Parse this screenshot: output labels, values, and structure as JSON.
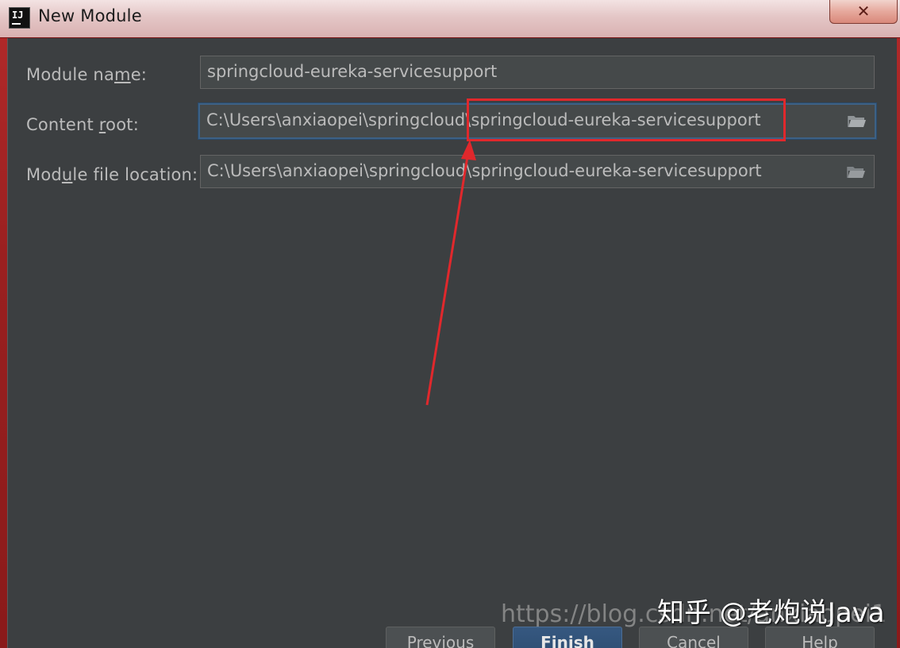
{
  "window": {
    "title": "New Module",
    "icon_label": "IJ",
    "close_symbol": "✕"
  },
  "fields": {
    "module_name": {
      "label_pre": "Module na",
      "label_mnemonic": "m",
      "label_post": "e:",
      "value": "springcloud-eureka-servicesupport"
    },
    "content_root": {
      "label_pre": "Content ",
      "label_mnemonic": "r",
      "label_post": "oot:",
      "value": "C:\\Users\\anxiaopei\\springcloud\\springcloud-eureka-servicesupport"
    },
    "module_file_location": {
      "label_pre": "Module file location:",
      "label_mnemonic": "",
      "label_post": "",
      "label_display_pre": "Mod",
      "label_display_mnemonic": "u",
      "label_display_post": "le file location:",
      "value": "C:\\Users\\anxiaopei\\springcloud\\springcloud-eureka-servicesupport"
    }
  },
  "buttons": {
    "previous": "Previous",
    "finish": "Finish",
    "cancel": "Cancel",
    "help": "Help"
  },
  "watermarks": {
    "url": "https://blog.csdn.net/anxiaopei1",
    "zhihu": "知乎 @老炮说Java"
  },
  "colors": {
    "dialog_bg": "#3c3f41",
    "field_bg": "#45494a",
    "text": "#bbbbbb",
    "annotation_red": "#e0282c",
    "focus_blue": "#3d6185"
  },
  "icons": {
    "folder": "folder-open-icon",
    "app": "intellij-idea-icon",
    "close": "close-icon"
  }
}
